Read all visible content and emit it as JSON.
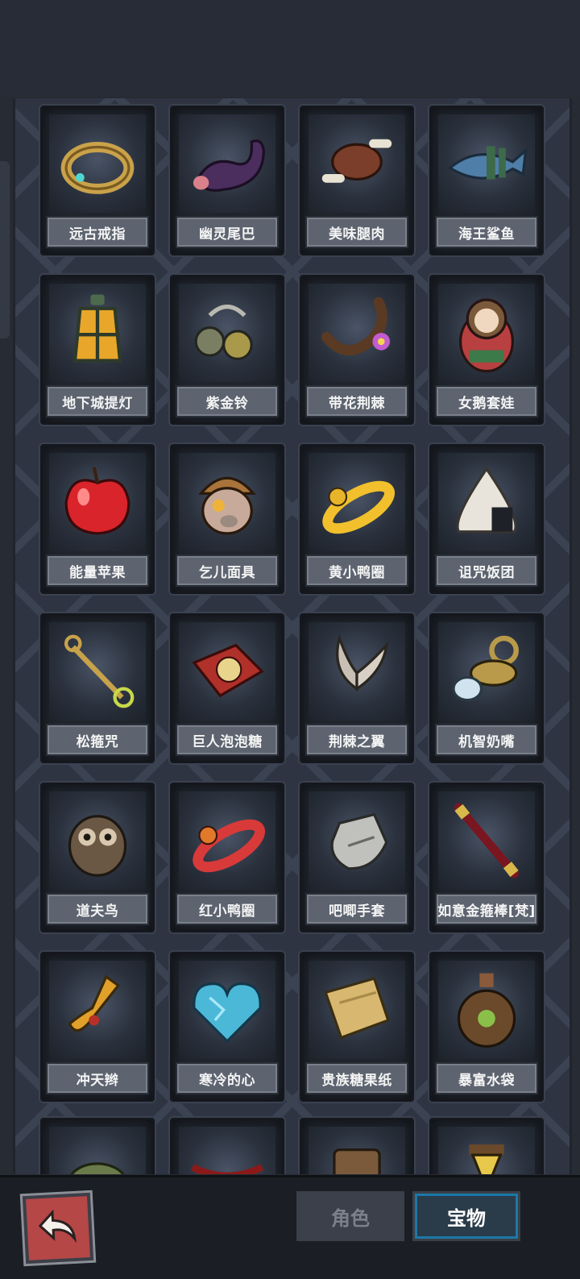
{
  "items": [
    {
      "name": "远古戒指",
      "icon": "ring-icon"
    },
    {
      "name": "幽灵尾巴",
      "icon": "tail-icon"
    },
    {
      "name": "美味腿肉",
      "icon": "meat-icon"
    },
    {
      "name": "海王鲨鱼",
      "icon": "shark-icon"
    },
    {
      "name": "地下城提灯",
      "icon": "lantern-icon"
    },
    {
      "name": "紫金铃",
      "icon": "bells-icon"
    },
    {
      "name": "带花荆棘",
      "icon": "thorn-flower-icon"
    },
    {
      "name": "女鹅套娃",
      "icon": "doll-icon"
    },
    {
      "name": "能量苹果",
      "icon": "apple-icon"
    },
    {
      "name": "乞儿面具",
      "icon": "mask-icon"
    },
    {
      "name": "黄小鸭圈",
      "icon": "yellow-duck-ring-icon"
    },
    {
      "name": "诅咒饭团",
      "icon": "riceball-icon"
    },
    {
      "name": "松箍咒",
      "icon": "staff-icon"
    },
    {
      "name": "巨人泡泡糖",
      "icon": "gum-box-icon"
    },
    {
      "name": "荆棘之翼",
      "icon": "wings-icon"
    },
    {
      "name": "机智奶嘴",
      "icon": "pacifier-icon"
    },
    {
      "name": "道夫鸟",
      "icon": "owl-icon"
    },
    {
      "name": "红小鸭圈",
      "icon": "red-duck-ring-icon"
    },
    {
      "name": "吧唧手套",
      "icon": "glove-icon"
    },
    {
      "name": "如意金箍棒[梵]",
      "icon": "golden-rod-icon"
    },
    {
      "name": "冲天辫",
      "icon": "pigtail-icon"
    },
    {
      "name": "寒冷的心",
      "icon": "ice-heart-icon"
    },
    {
      "name": "贵族糖果纸",
      "icon": "candy-paper-icon"
    },
    {
      "name": "暴富水袋",
      "icon": "water-bag-icon"
    }
  ],
  "bottom_nav": {
    "back_icon": "back-arrow-icon",
    "tab_role": "角色",
    "tab_treasure": "宝物",
    "active_tab": "宝物"
  },
  "colors": {
    "active_tab_border": "#1c78a8",
    "back_button": "#b54747"
  }
}
